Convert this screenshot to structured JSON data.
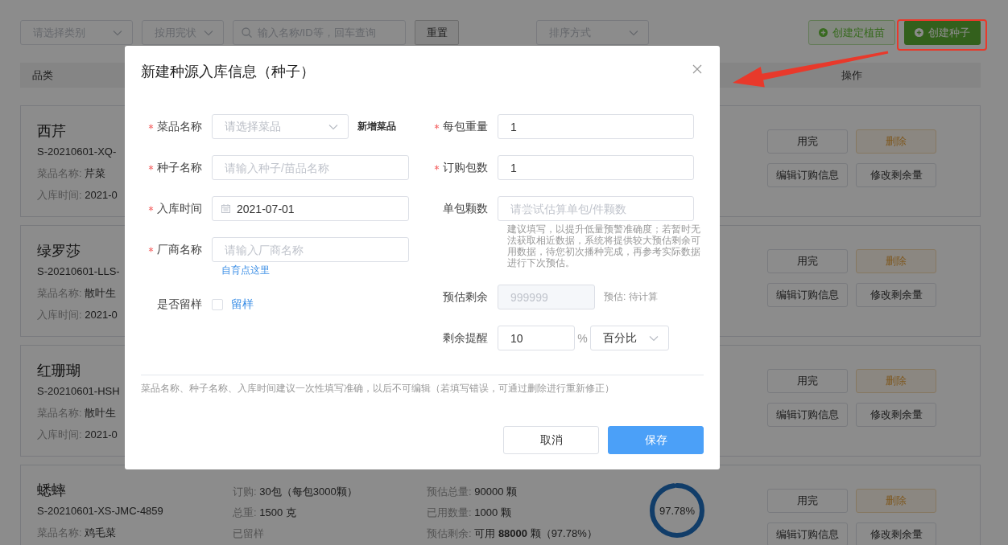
{
  "filters": [
    {
      "kind": "select",
      "placeholder": "请选择类别"
    },
    {
      "kind": "select",
      "placeholder": "按用完状"
    },
    {
      "kind": "search",
      "placeholder": "输入名称/ID等，回车查询"
    },
    {
      "kind": "button",
      "label": "重置"
    },
    {
      "kind": "select",
      "placeholder": "排序方式"
    }
  ],
  "actions": [
    {
      "label": "创建定植苗",
      "kind": "outline",
      "highlighted": false
    },
    {
      "label": "创建种子",
      "kind": "primary",
      "highlighted": true
    }
  ],
  "table": {
    "columns": [
      "品类",
      "操作"
    ]
  },
  "cards": [
    {
      "name": "西芹",
      "code": "S-20210601-XQ-",
      "lines": [
        {
          "label": "菜品名称:",
          "value": "芹菜"
        },
        {
          "label": "入库时间:",
          "value": "2021-0"
        }
      ],
      "buttons": [
        {
          "label": "用完",
          "kind": "default"
        },
        {
          "label": "删除",
          "kind": "danger"
        },
        {
          "label": "编辑订购信息",
          "kind": "default"
        },
        {
          "label": "修改剩余量",
          "kind": "default"
        }
      ]
    },
    {
      "name": "绿罗莎",
      "code": "S-20210601-LLS-",
      "lines": [
        {
          "label": "菜品名称:",
          "value": "散叶生"
        },
        {
          "label": "入库时间:",
          "value": "2021-0"
        }
      ],
      "buttons": [
        {
          "label": "用完",
          "kind": "default"
        },
        {
          "label": "删除",
          "kind": "danger"
        },
        {
          "label": "编辑订购信息",
          "kind": "default"
        },
        {
          "label": "修改剩余量",
          "kind": "default"
        }
      ]
    },
    {
      "name": "红珊瑚",
      "code": "S-20210601-HSH",
      "lines": [
        {
          "label": "菜品名称:",
          "value": "散叶生"
        },
        {
          "label": "入库时间:",
          "value": "2021-0"
        }
      ],
      "buttons": [
        {
          "label": "用完",
          "kind": "default"
        },
        {
          "label": "删除",
          "kind": "danger"
        },
        {
          "label": "编辑订购信息",
          "kind": "default"
        },
        {
          "label": "修改剩余量",
          "kind": "default"
        }
      ]
    },
    {
      "name": "蟋蟀",
      "code": "S-20210601-XS-JMC-4859",
      "lines": [
        {
          "label": "菜品名称:",
          "value": "鸡毛菜"
        }
      ],
      "details": [
        [
          {
            "label": "订购:",
            "value": "30包（每包3000颗）"
          },
          {
            "label": "总重:",
            "value": "1500 克"
          },
          {
            "label": "已留样"
          }
        ],
        [
          {
            "label": "预估总量:",
            "value": "90000 颗"
          },
          {
            "label": "已用数量:",
            "value": "1000 颗"
          },
          {
            "label": "预估剩余:",
            "value": "可用 **88000** 颗（97.78%）"
          }
        ]
      ],
      "ring": {
        "level": 0.9778,
        "text": "97.78%"
      },
      "buttons": [
        {
          "label": "用完",
          "kind": "default"
        },
        {
          "label": "删除",
          "kind": "danger"
        },
        {
          "label": "编辑订购信息",
          "kind": "default"
        },
        {
          "label": "修改剩余量",
          "kind": "default"
        }
      ]
    }
  ],
  "dialog": {
    "title": "新建种源入库信息（种子）",
    "left": [
      {
        "label": "菜品名称",
        "required": true,
        "kind": "select",
        "placeholder": "请选择菜品",
        "extra": "新增菜品"
      },
      {
        "label": "种子名称",
        "required": true,
        "kind": "input",
        "placeholder": "请输入种子/苗品名称"
      },
      {
        "label": "入库时间",
        "required": true,
        "kind": "date",
        "value": "2021-07-01"
      },
      {
        "label": "厂商名称",
        "required": true,
        "kind": "input",
        "placeholder": "请输入厂商名称",
        "link": "自育点这里"
      },
      {
        "label": "是否留样",
        "required": false,
        "kind": "checkbox",
        "checked": false,
        "option": "留样"
      }
    ],
    "right": [
      {
        "label": "每包重量",
        "required": true,
        "kind": "input",
        "value": "1"
      },
      {
        "label": "订购包数",
        "required": true,
        "kind": "input",
        "value": "1"
      },
      {
        "label": "单包颗数",
        "required": false,
        "kind": "input",
        "placeholder": "请尝试估算单包/件颗数",
        "help": "建议填写，以提升低量预警准确度；若暂时无法获取相近数据，系统将提供较大预估剩余可用数据，待您初次播种完成，再参考实际数据进行下次预估。"
      },
      {
        "label": "预估剩余",
        "required": false,
        "kind": "input",
        "disabled": true,
        "placeholder": "999999",
        "suffix": "预估: 待计算"
      },
      {
        "label": "剩余提醒",
        "required": false,
        "kind": "percent",
        "value": "10",
        "unit": "%",
        "select": "百分比"
      }
    ],
    "note": "菜品名称、种子名称、入库时间建议一次性填写准确，以后不可编辑（若填写错误，可通过删除进行重新修正）",
    "buttons": [
      {
        "label": "取消",
        "kind": "default"
      },
      {
        "label": "保存",
        "kind": "primary"
      }
    ]
  }
}
